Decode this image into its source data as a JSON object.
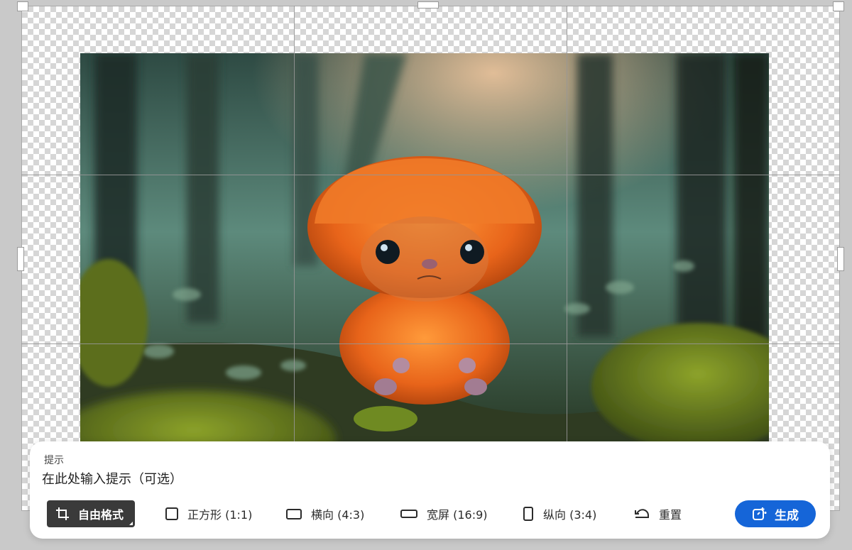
{
  "prompt": {
    "label": "提示",
    "placeholder": "在此处输入提示（可选）"
  },
  "aspect_options": [
    {
      "label": "自由格式",
      "icon": "crop-icon",
      "selected": true
    },
    {
      "label": "正方形 (1:1)",
      "icon": "square-icon",
      "selected": false
    },
    {
      "label": "横向 (4:3)",
      "icon": "landscape-icon",
      "selected": false
    },
    {
      "label": "宽屏 (16:9)",
      "icon": "widescreen-icon",
      "selected": false
    },
    {
      "label": "纵向 (3:4)",
      "icon": "portrait-icon",
      "selected": false
    }
  ],
  "reset_label": "重置",
  "generate_label": "生成",
  "colors": {
    "accent": "#1565d8",
    "selected_bg": "#3a3a3a"
  }
}
